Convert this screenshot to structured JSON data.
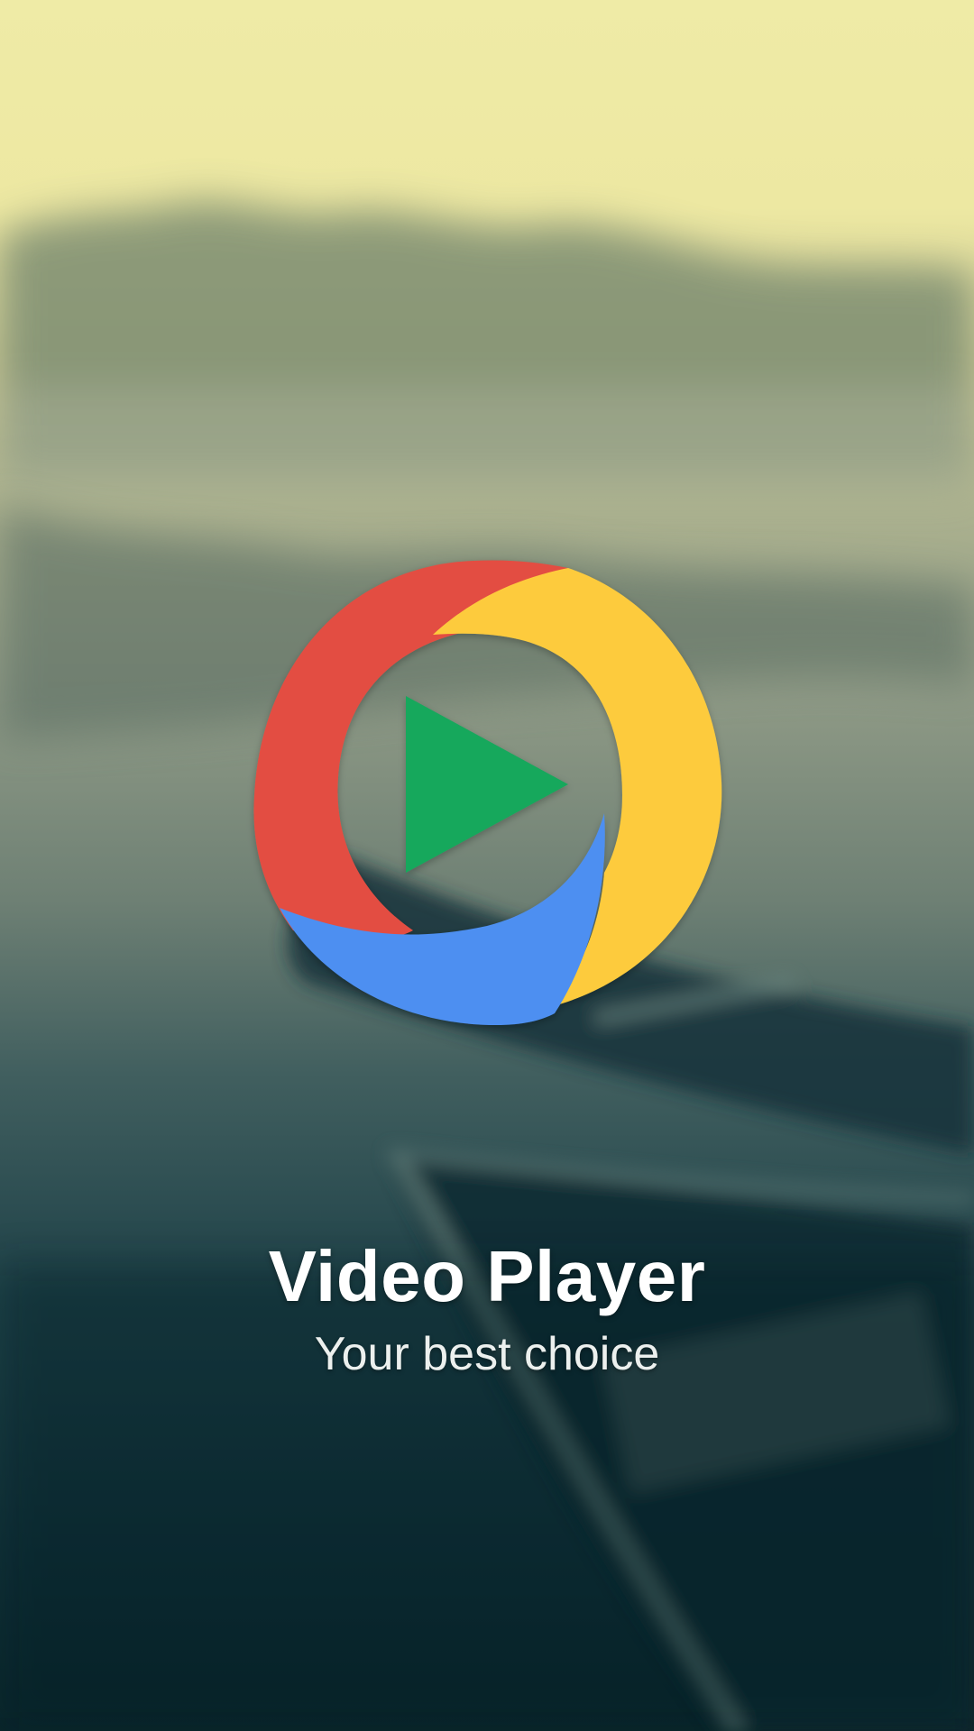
{
  "app": {
    "title": "Video Player",
    "tagline": "Your best choice"
  },
  "logo": {
    "icon": "play-circle-icon",
    "colors": {
      "red": "#E34E42",
      "yellow": "#FDCB3E",
      "blue": "#4E8FF1",
      "green": "#16A85C"
    }
  },
  "background": {
    "scene": "misty lake with rowing boat",
    "colors": {
      "sky": "#EFEBA6",
      "trees": "#8C9477",
      "water_dark": "#0B2B31"
    }
  }
}
